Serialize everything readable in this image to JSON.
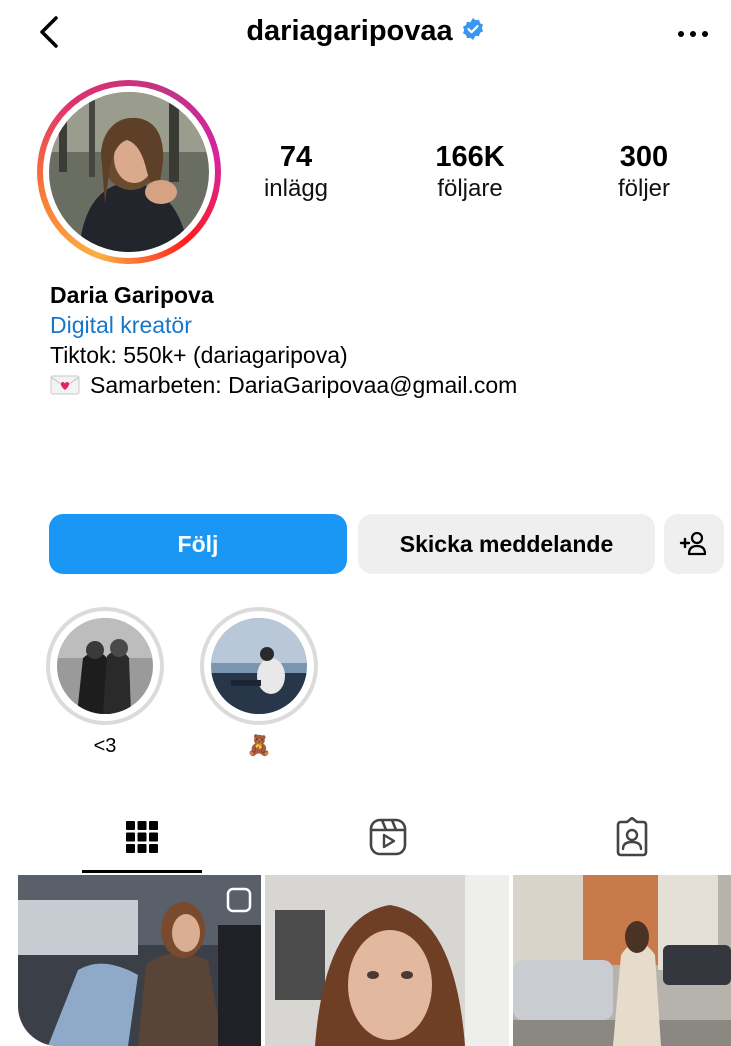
{
  "header": {
    "username": "dariagaripovaa",
    "verified": true,
    "back_icon": "chevron-left-icon",
    "more_icon": "more-horizontal-icon"
  },
  "stats": [
    {
      "value": "74",
      "label": "inlägg"
    },
    {
      "value": "166K",
      "label": "följare"
    },
    {
      "value": "300",
      "label": "följer"
    }
  ],
  "bio": {
    "name": "Daria Garipova",
    "category": "Digital kreatör",
    "line1": "Tiktok: 550k+ (dariagaripova)",
    "line2": "Samarbeten: DariaGaripovaa@gmail.com",
    "line2_icon": "love-letter-icon"
  },
  "actions": {
    "follow_label": "Följ",
    "message_label": "Skicka meddelande",
    "add_icon": "add-person-icon"
  },
  "highlights": [
    {
      "label": "<3"
    },
    {
      "label": "🧸"
    }
  ],
  "tabs": [
    {
      "icon": "grid-icon",
      "active": true
    },
    {
      "icon": "reels-icon",
      "active": false
    },
    {
      "icon": "tagged-icon",
      "active": false
    }
  ],
  "colors": {
    "accent": "#1a97f5",
    "link": "#1877c9",
    "verified": "#3897f0",
    "secondary_button": "#efefef"
  }
}
